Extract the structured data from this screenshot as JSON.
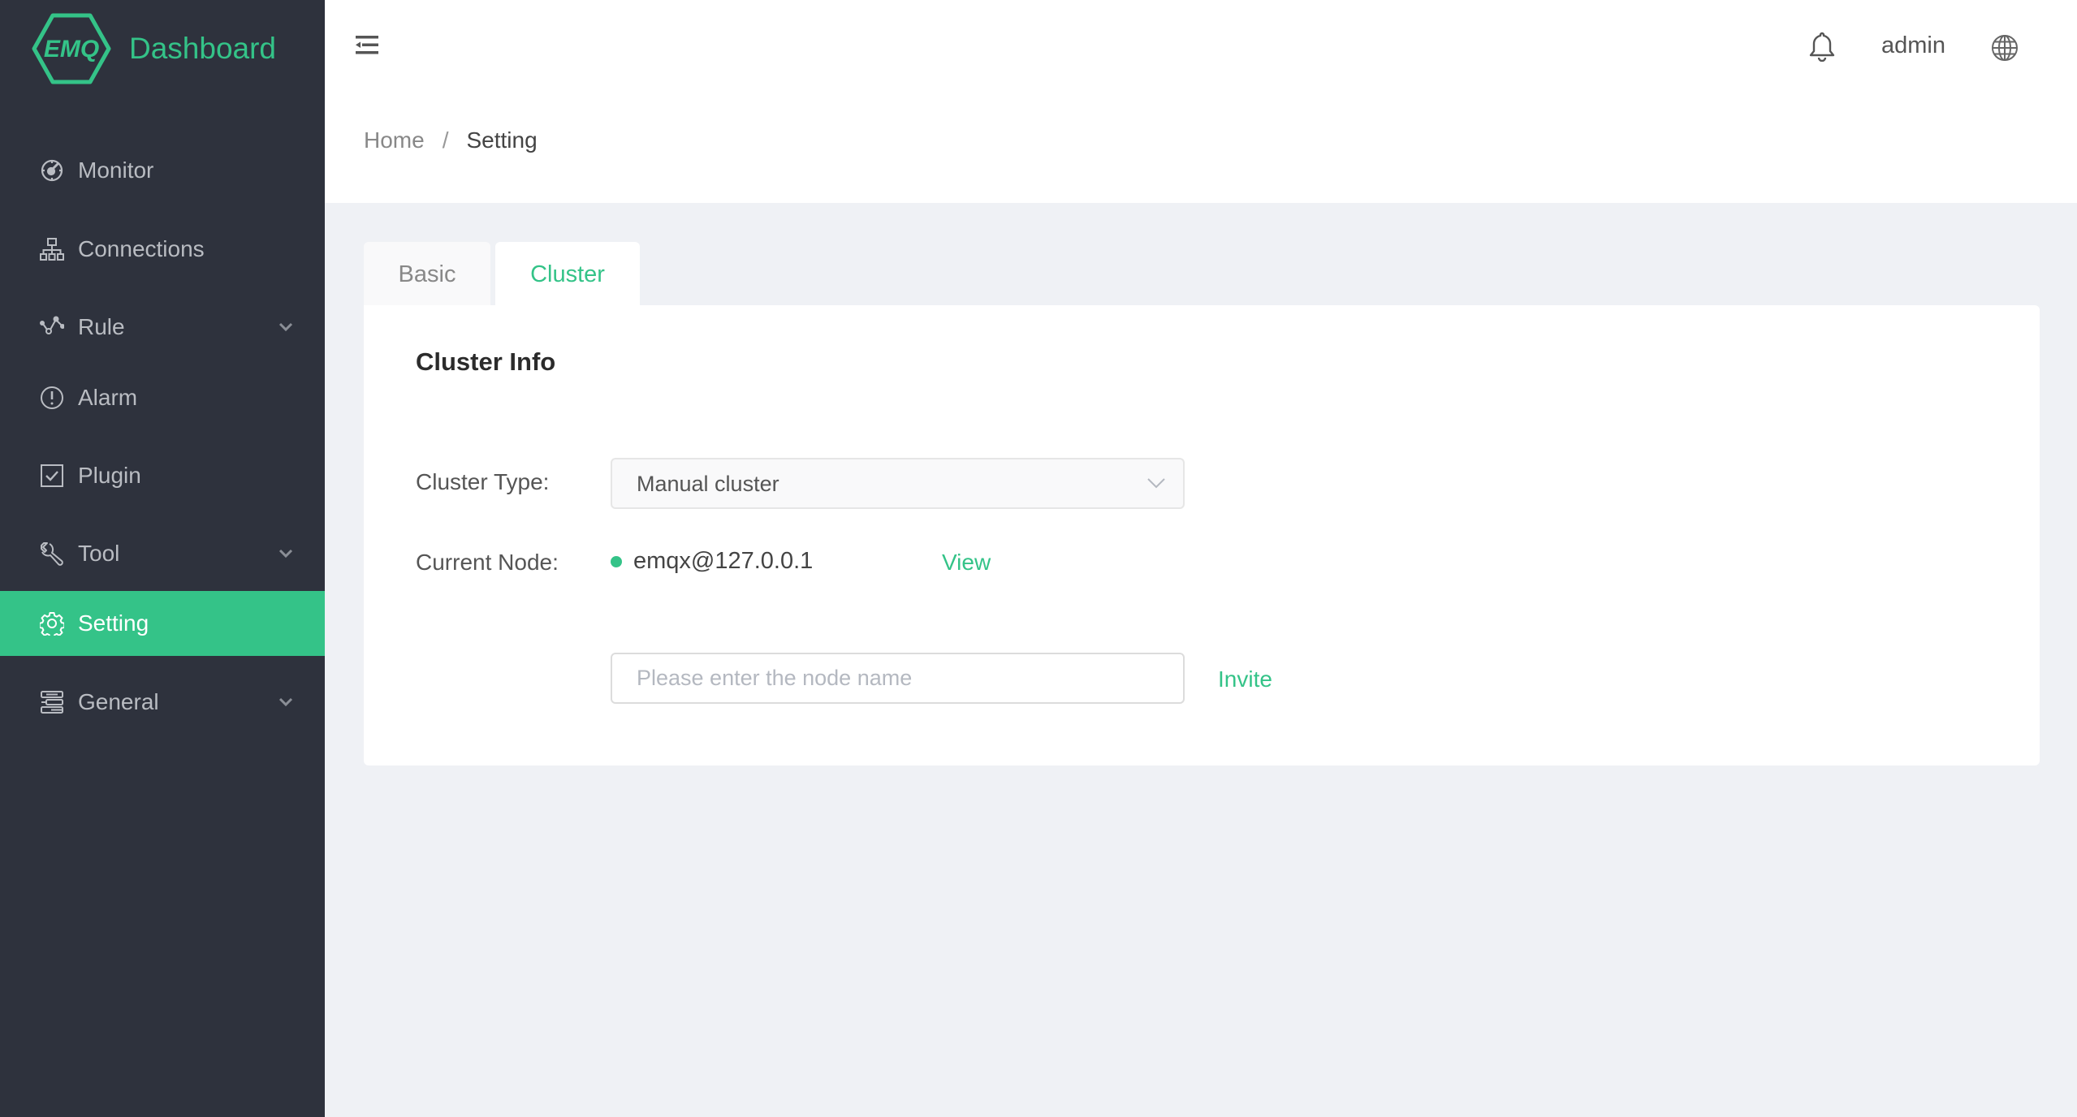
{
  "app": {
    "logo_text": "EMQ",
    "title": "Dashboard",
    "accent_color": "#34c388"
  },
  "sidebar": {
    "items": [
      {
        "label": "Monitor",
        "icon": "monitor-gauge-icon",
        "has_submenu": false,
        "active": false
      },
      {
        "label": "Connections",
        "icon": "connections-tree-icon",
        "has_submenu": false,
        "active": false
      },
      {
        "label": "Rule",
        "icon": "rule-nodes-icon",
        "has_submenu": true,
        "active": false
      },
      {
        "label": "Alarm",
        "icon": "alarm-exclamation-icon",
        "has_submenu": false,
        "active": false
      },
      {
        "label": "Plugin",
        "icon": "plugin-checkbox-icon",
        "has_submenu": false,
        "active": false
      },
      {
        "label": "Tool",
        "icon": "tool-wrench-icon",
        "has_submenu": true,
        "active": false
      },
      {
        "label": "Setting",
        "icon": "setting-gear-icon",
        "has_submenu": false,
        "active": true
      },
      {
        "label": "General",
        "icon": "general-stack-icon",
        "has_submenu": true,
        "active": false
      }
    ]
  },
  "header": {
    "user": "admin",
    "icons": [
      "collapse-menu-icon",
      "bell-icon",
      "globe-icon"
    ]
  },
  "breadcrumb": {
    "home": "Home",
    "separator": "/",
    "current": "Setting"
  },
  "tabs": [
    {
      "label": "Basic",
      "active": false
    },
    {
      "label": "Cluster",
      "active": true
    }
  ],
  "cluster": {
    "title": "Cluster Info",
    "cluster_type_label": "Cluster Type:",
    "cluster_type_value": "Manual cluster",
    "current_node_label": "Current Node:",
    "current_node_value": "emqx@127.0.0.1",
    "node_status_color": "#34c388",
    "view_label": "View",
    "node_input_placeholder": "Please enter the node name",
    "node_input_value": "",
    "invite_label": "Invite"
  }
}
